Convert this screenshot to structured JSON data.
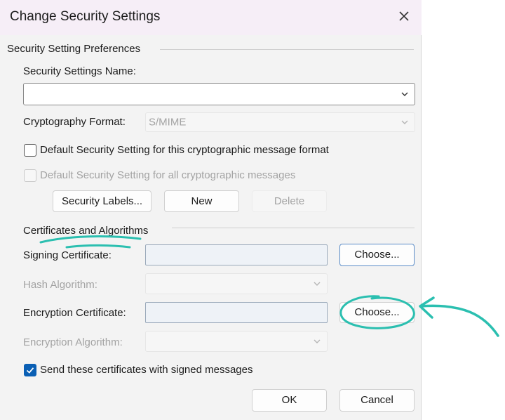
{
  "dialog": {
    "title": "Change Security Settings",
    "close_icon": "close-icon"
  },
  "preferences": {
    "group_title": "Security Setting Preferences",
    "name_label": "Security Settings Name:",
    "name_value": "",
    "crypto_label": "Cryptography Format:",
    "crypto_value": "S/MIME",
    "default_format_label": "Default Security Setting for this cryptographic message format",
    "default_format_checked": false,
    "default_all_label": "Default Security Setting for all cryptographic messages",
    "default_all_checked": false,
    "security_labels_button": "Security Labels...",
    "new_button": "New",
    "delete_button": "Delete"
  },
  "certificates": {
    "group_title": "Certificates and Algorithms",
    "signing_label": "Signing Certificate:",
    "signing_value": "",
    "choose_signing_button": "Choose...",
    "hash_label": "Hash Algorithm:",
    "hash_value": "",
    "encryption_label": "Encryption Certificate:",
    "encryption_value": "",
    "choose_encryption_button": "Choose...",
    "encryption_algorithm_label": "Encryption Algorithm:",
    "encryption_algorithm_value": "",
    "send_label": "Send these certificates with signed messages",
    "send_checked": true
  },
  "footer": {
    "ok_button": "OK",
    "cancel_button": "Cancel"
  },
  "colors": {
    "accent": "#0a5fb4",
    "annotation": "#2bbfb0",
    "title_bar": "#f6eef7"
  }
}
